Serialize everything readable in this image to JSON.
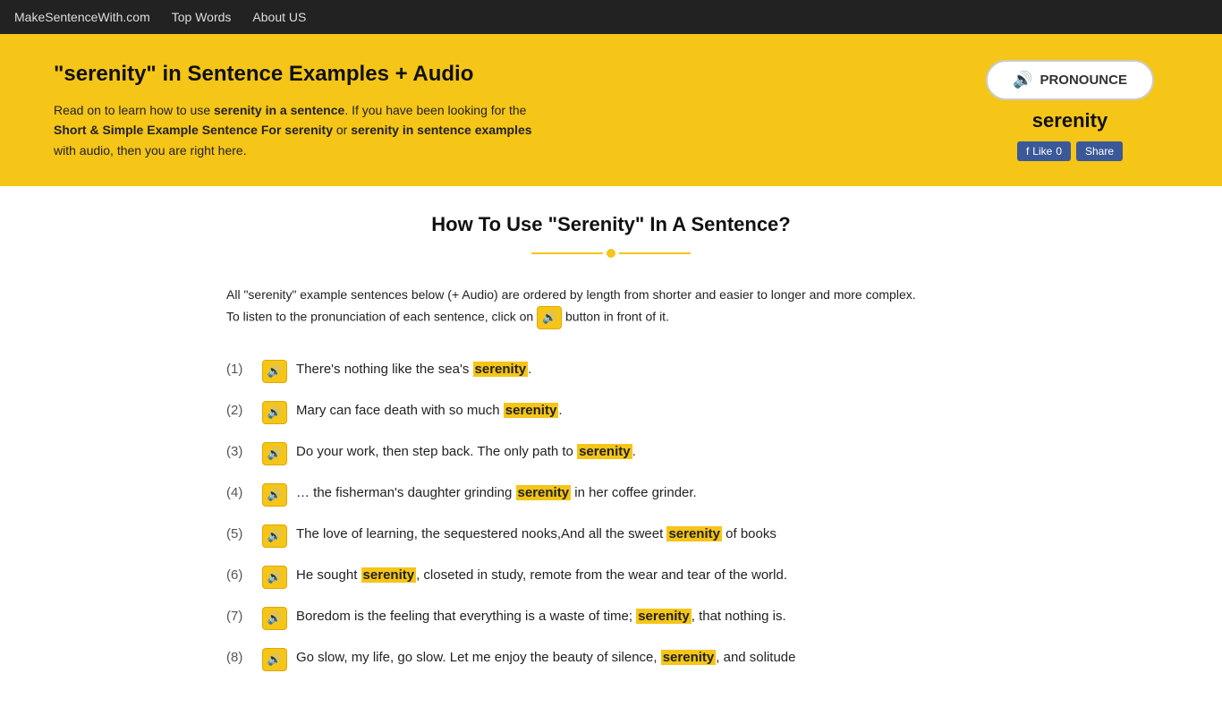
{
  "nav": {
    "site_name": "MakeSentenceWith.com",
    "links": [
      {
        "label": "Top Words",
        "href": "#"
      },
      {
        "label": "About US",
        "href": "#"
      }
    ]
  },
  "hero": {
    "title": "\"serenity\" in Sentence Examples + Audio",
    "description_parts": [
      {
        "text": "Read on to learn how to use ",
        "type": "plain"
      },
      {
        "text": "serenity in a sentence",
        "type": "bold"
      },
      {
        "text": ". If you have been looking for the ",
        "type": "plain"
      },
      {
        "text": "Short & Simple Example Sentence For serenity",
        "type": "bold"
      },
      {
        "text": " or ",
        "type": "plain"
      },
      {
        "text": "serenity in sentence examples",
        "type": "bold-link"
      },
      {
        "text": " with audio, then you are right here.",
        "type": "plain"
      }
    ],
    "pronounce_label": "PRONOUNCE",
    "word": "serenity",
    "fb_like": "fb Like 0",
    "fb_share": "Share"
  },
  "content": {
    "section_title": "How To Use \"Serenity\" In A Sentence?",
    "intro": "All \"serenity\" example sentences below (+ Audio) are ordered by length from shorter and easier to longer and more complex. To listen to the pronunciation of each sentence, click on",
    "intro_suffix": "button in front of it.",
    "sentences": [
      {
        "num": 1,
        "text_before": "There's nothing like the sea's ",
        "highlight": "serenity",
        "text_after": "."
      },
      {
        "num": 2,
        "text_before": "Mary can face death with so much ",
        "highlight": "serenity",
        "text_after": "."
      },
      {
        "num": 3,
        "text_before": "Do your work, then step back. The only path to ",
        "highlight": "serenity",
        "text_after": "."
      },
      {
        "num": 4,
        "text_before": "… the fisherman's daughter grinding ",
        "highlight": "serenity",
        "text_after": " in her coffee grinder."
      },
      {
        "num": 5,
        "text_before": "The love of learning, the sequestered nooks,And all the sweet ",
        "highlight": "serenity",
        "text_after": " of books"
      },
      {
        "num": 6,
        "text_before": "He sought ",
        "highlight": "serenity",
        "text_after": ", closeted in study, remote from the wear and tear of the world."
      },
      {
        "num": 7,
        "text_before": "Boredom is the feeling that everything is a waste of time; ",
        "highlight": "serenity",
        "text_after": ", that nothing is."
      },
      {
        "num": 8,
        "text_before": "Go slow, my life, go slow. Let me enjoy the beauty of silence, ",
        "highlight": "serenity",
        "text_after": ", and solitude"
      }
    ]
  }
}
